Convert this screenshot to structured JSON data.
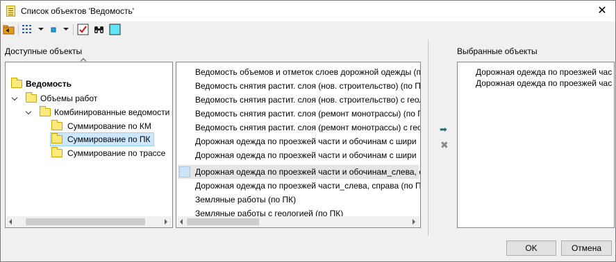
{
  "window": {
    "title": "Список объектов 'Ведомость'",
    "close_glyph": "✕"
  },
  "toolbar": {
    "icons": [
      "back-folder-icon",
      "tree-view-icon",
      "square-icon",
      "checklist-icon",
      "binoculars-icon",
      "color-box-icon"
    ],
    "checkmark_glyph": "✔",
    "binoculars_glyph": "⛭"
  },
  "available": {
    "label": "Доступные объекты",
    "tree": [
      {
        "label": "Ведомость",
        "bold": true
      },
      {
        "label": "Объемы работ"
      },
      {
        "label": "Комбинированные ведомости"
      },
      {
        "label": "Суммирование по КМ"
      },
      {
        "label": "Суммирование по ПК",
        "selected": true
      },
      {
        "label": "Суммирование по трассе"
      }
    ],
    "list": [
      "Ведомость объемов и отметок слоев дорожной одежды (по",
      "Ведомость снятия растит. слоя (нов. строительство)  (по П",
      "Ведомость снятия растит. слоя (нов. строительство) с геол",
      "Ведомость снятия растит. слоя (ремонт монотрассы) (по П",
      "Ведомость снятия растит. слоя (ремонт монотрассы) с гео",
      "Дорожная одежда по проезжей части и обочинам с шири",
      "Дорожная одежда по проезжей части и обочинам с шири",
      "Дорожная одежда по проезжей части и обочинам_слева, с",
      "Дорожная одежда по проезжей части_слева, справа (по ПК",
      "Земляные работы (по ПК)",
      "Земляные работы с геологией (по ПК)"
    ]
  },
  "transfer": {
    "add_glyph": "➡",
    "remove_glyph": "✖"
  },
  "selected": {
    "label": "Выбранные объекты",
    "items": [
      "Дорожная одежда по проезжей час",
      "Дорожная одежда по проезжей час"
    ]
  },
  "buttons": {
    "ok": "OK",
    "cancel": "Отмена"
  },
  "colors": {
    "accent": "#0078d7",
    "selection": "#cce8ff",
    "window_bg": "#f0f0f0"
  }
}
